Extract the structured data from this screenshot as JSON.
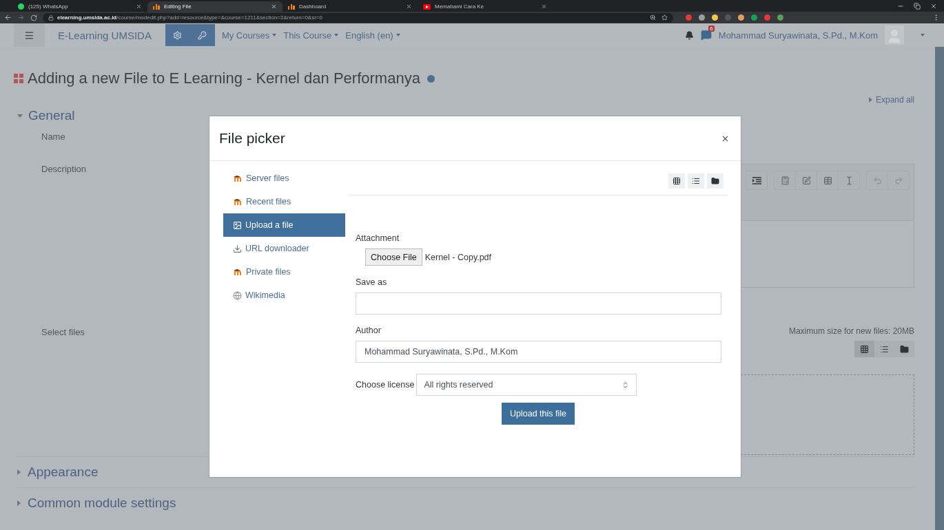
{
  "browser": {
    "tabs": [
      {
        "title": "(125) WhatsApp",
        "selected": false,
        "kind": "chat"
      },
      {
        "title": "Editing File",
        "selected": true,
        "kind": "site"
      },
      {
        "title": "Dashboard",
        "selected": false,
        "kind": "site"
      },
      {
        "title": "Memahami Cara Ke",
        "selected": false,
        "kind": "video"
      }
    ],
    "url": {
      "host": "elearning.umsida.ac.id",
      "path": "/course/modedit.php?add=resource&type=&course=1211&section=2&return=0&sr=0"
    }
  },
  "navbar": {
    "brand": "E-Learning UMSIDA",
    "menus": [
      "My Courses",
      "This Course",
      "English (en)"
    ],
    "message_count": "6",
    "user": "Mohammad Suryawinata, S.Pd., M.Kom"
  },
  "page": {
    "title": "Adding a new File to E Learning - Kernel dan Performanya",
    "expand_all": "Expand all",
    "sections": [
      {
        "label": "General",
        "expanded": true,
        "fields": [
          {
            "label": "Name",
            "kind": "text"
          },
          {
            "label": "Description",
            "kind": "editor"
          },
          {
            "label": "Select files",
            "kind": "files",
            "note": "Maximum size for new files: 20MB",
            "view_modes": [
              {
                "kind": "icons",
                "selected": true
              },
              {
                "kind": "list",
                "selected": false
              },
              {
                "kind": "tree",
                "selected": false
              }
            ]
          }
        ]
      },
      {
        "label": "Appearance",
        "expanded": false
      },
      {
        "label": "Common module settings",
        "expanded": false
      }
    ]
  },
  "dialog": {
    "title": "File picker",
    "repositories": [
      {
        "label": "Server files",
        "kind": "moodle",
        "selected": false
      },
      {
        "label": "Recent files",
        "kind": "moodle",
        "selected": false
      },
      {
        "label": "Upload a file",
        "kind": "upload",
        "selected": true
      },
      {
        "label": "URL downloader",
        "kind": "download",
        "selected": false
      },
      {
        "label": "Private files",
        "kind": "moodle",
        "selected": false
      },
      {
        "label": "Wikimedia",
        "kind": "globe",
        "selected": false
      }
    ],
    "attachment_label": "Attachment",
    "choose_file": "Choose File",
    "file_name": "Kernel - Copy.pdf",
    "save_as_label": "Save as",
    "author_label": "Author",
    "author": "Mohammad Suryawinata, S.Pd., M.Kom",
    "license_label": "Choose license",
    "license": "All rights reserved",
    "submit": "Upload this file"
  }
}
